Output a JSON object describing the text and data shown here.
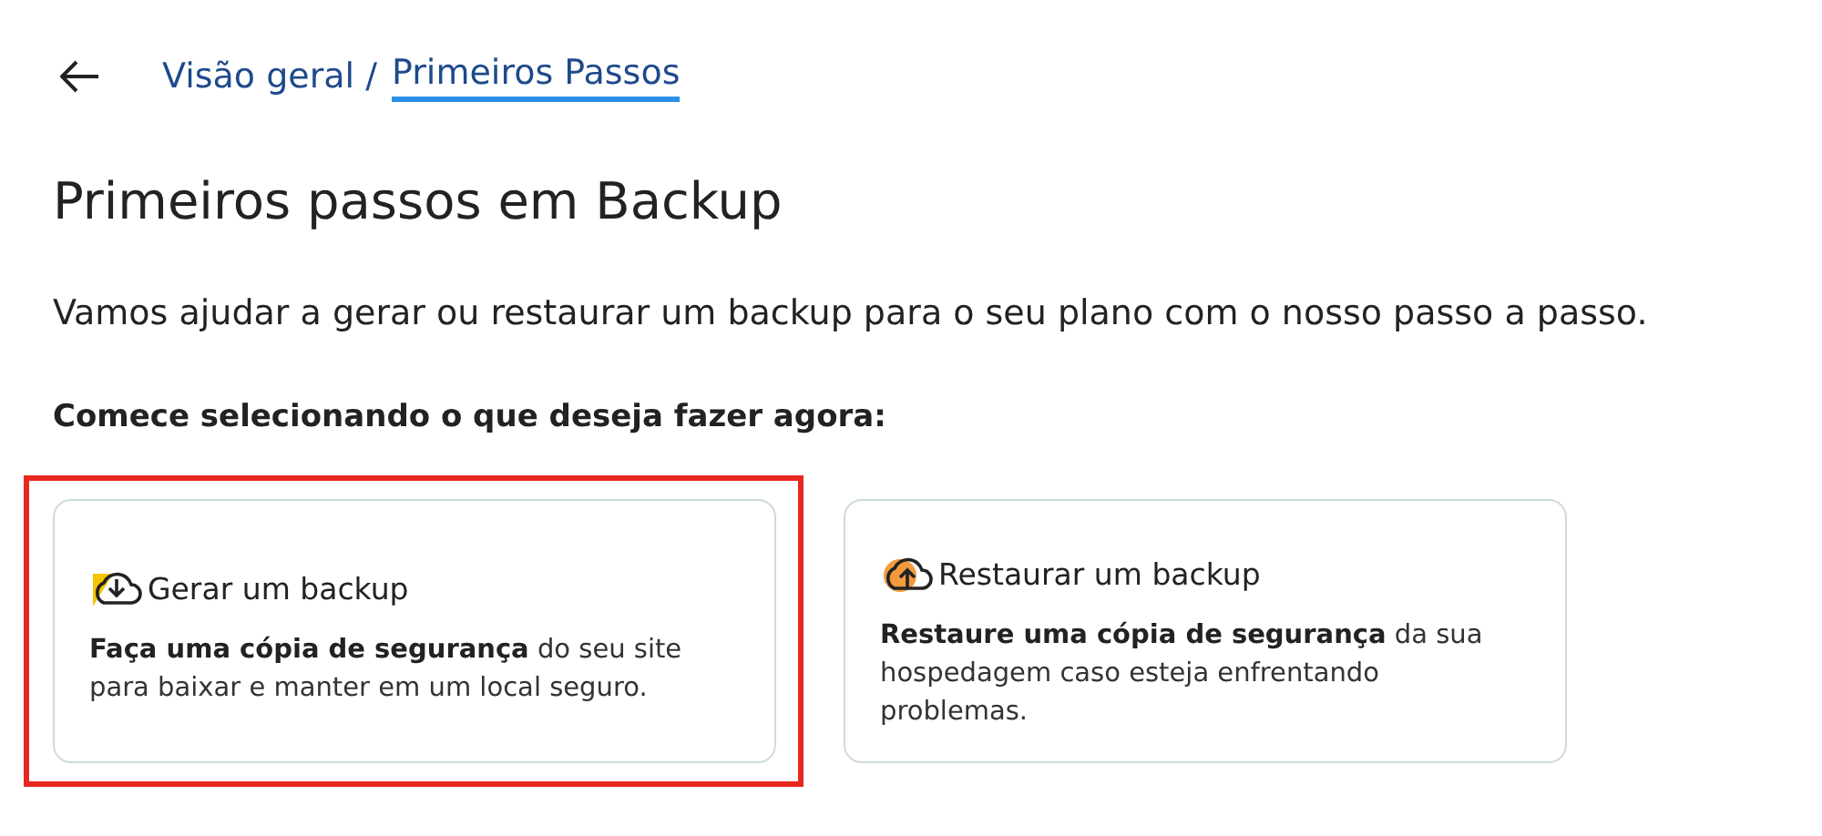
{
  "breadcrumb": {
    "parent": "Visão geral /",
    "current": "Primeiros Passos"
  },
  "title": "Primeiros passos em Backup",
  "intro": "Vamos ajudar a gerar ou restaurar um backup para o seu plano com o nosso passo a passo.",
  "prompt": "Comece selecionando o que deseja fazer agora:",
  "options": [
    {
      "kind": "download",
      "label": "Gerar um backup",
      "description": "**Faça uma cópia de segurança** do seu site para baixar e manter em um local seguro.",
      "highlighted": true
    },
    {
      "kind": "upload",
      "label": "Restaurar um backup",
      "description": "**Restaure uma cópia de segurança** da sua hospedagem caso esteja enfrentando problemas.",
      "highlighted": false
    }
  ]
}
